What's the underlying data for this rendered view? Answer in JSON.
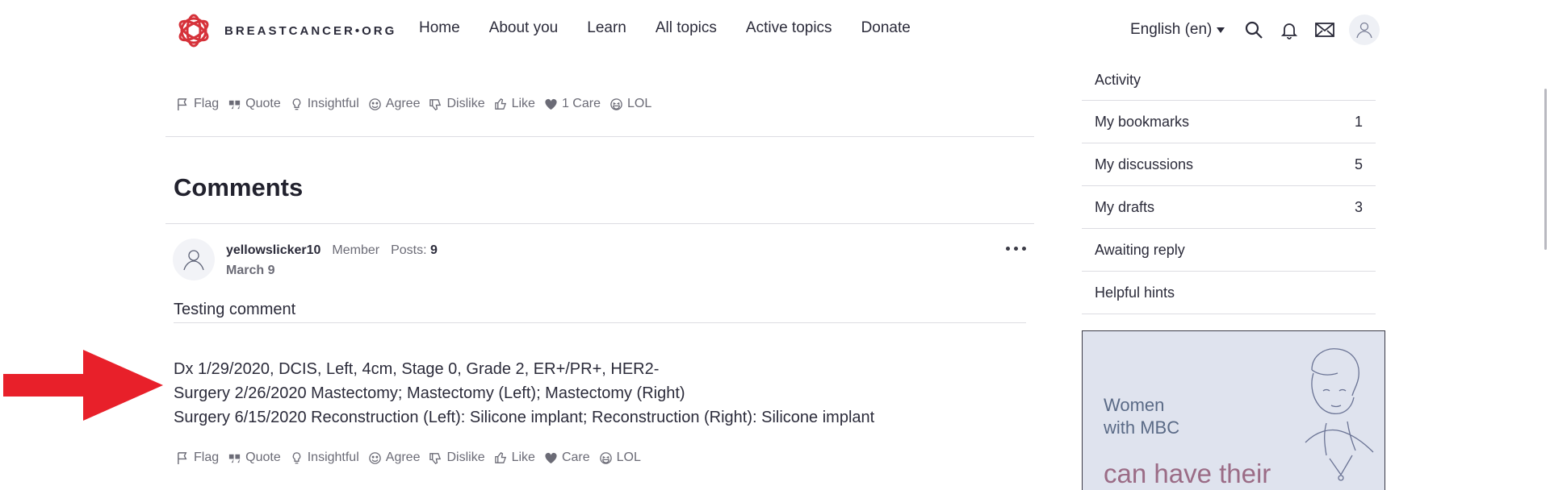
{
  "header": {
    "logo_text": "BREASTCANCER•ORG",
    "nav": [
      "Home",
      "About you",
      "Learn",
      "All topics",
      "Active topics",
      "Donate"
    ],
    "language": "English (en)"
  },
  "top_reactions": {
    "flag": "Flag",
    "quote": "Quote",
    "insightful": "Insightful",
    "agree": "Agree",
    "dislike": "Dislike",
    "like": "Like",
    "care": "1 Care",
    "lol": "LOL"
  },
  "comments": {
    "title": "Comments",
    "items": [
      {
        "author": "yellowslicker10",
        "role": "Member",
        "posts_label": "Posts:",
        "posts_count": "9",
        "date": "March 9",
        "text": "Testing comment",
        "signature": [
          "Dx 1/29/2020, DCIS, Left, 4cm, Stage 0, Grade 2, ER+/PR+, HER2-",
          "Surgery 2/26/2020 Mastectomy; Mastectomy (Left); Mastectomy (Right)",
          "Surgery 6/15/2020 Reconstruction (Left): Silicone implant; Reconstruction (Right): Silicone implant"
        ],
        "reactions": {
          "flag": "Flag",
          "quote": "Quote",
          "insightful": "Insightful",
          "agree": "Agree",
          "dislike": "Dislike",
          "like": "Like",
          "care": "Care",
          "lol": "LOL"
        }
      }
    ]
  },
  "sidebar": {
    "items": [
      {
        "label": "Activity",
        "count": ""
      },
      {
        "label": "My bookmarks",
        "count": "1"
      },
      {
        "label": "My discussions",
        "count": "5"
      },
      {
        "label": "My drafts",
        "count": "3"
      },
      {
        "label": "Awaiting reply",
        "count": ""
      },
      {
        "label": "Helpful hints",
        "count": ""
      }
    ]
  },
  "ad": {
    "line1": "Women",
    "line2": "with MBC",
    "line3": "can have their"
  },
  "colors": {
    "brand": "#d6323a",
    "arrow": "#e8202a",
    "text": "#2b2b3a",
    "muted": "#6b6b76"
  },
  "icons": [
    "search-icon",
    "bell-icon",
    "mail-icon",
    "user-icon",
    "flag-icon",
    "quote-icon",
    "lightbulb-icon",
    "smile-icon",
    "thumbs-down-icon",
    "thumbs-up-icon",
    "heart-icon",
    "laugh-icon",
    "more-icon"
  ]
}
